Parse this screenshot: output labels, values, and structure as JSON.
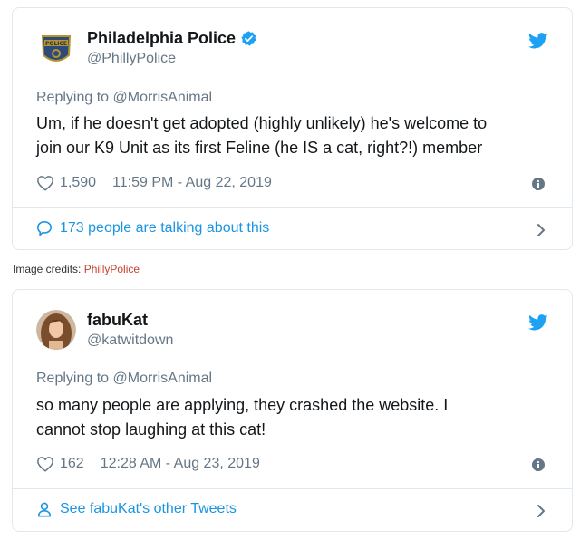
{
  "tweets": [
    {
      "display_name": "Philadelphia Police",
      "handle": "@PhillyPolice",
      "verified": true,
      "avatar_icon": "police-badge-icon",
      "reply_to": "Replying to @MorrisAnimal",
      "text_line1": "Um, if he doesn't get adopted (highly unlikely) he's welcome to",
      "text_line2": "join our K9 Unit as its first Feline (he IS a cat, right?!) member",
      "likes": "1,590",
      "timestamp": "11:59 PM - Aug 22, 2019",
      "footer_text": "173 people are talking about this",
      "footer_icon": "speech-bubble-icon"
    },
    {
      "display_name": "fabuKat",
      "handle": "@katwitdown",
      "verified": false,
      "avatar_icon": "user-photo",
      "reply_to": "Replying to @MorrisAnimal",
      "text_line1": "so many people are applying, they crashed the website.  I",
      "text_line2": "cannot stop laughing at this cat!",
      "likes": "162",
      "timestamp": "12:28 AM - Aug 23, 2019",
      "footer_text": "See fabuKat's other Tweets",
      "footer_icon": "person-icon"
    }
  ],
  "credits": {
    "label": "Image credits: ",
    "source": "PhillyPolice"
  },
  "colors": {
    "twitter_blue": "#1da1f2",
    "link_blue": "#1b95e0",
    "secondary_text": "#657786",
    "border": "#e1e8ed",
    "credit_red": "#c8412e"
  }
}
